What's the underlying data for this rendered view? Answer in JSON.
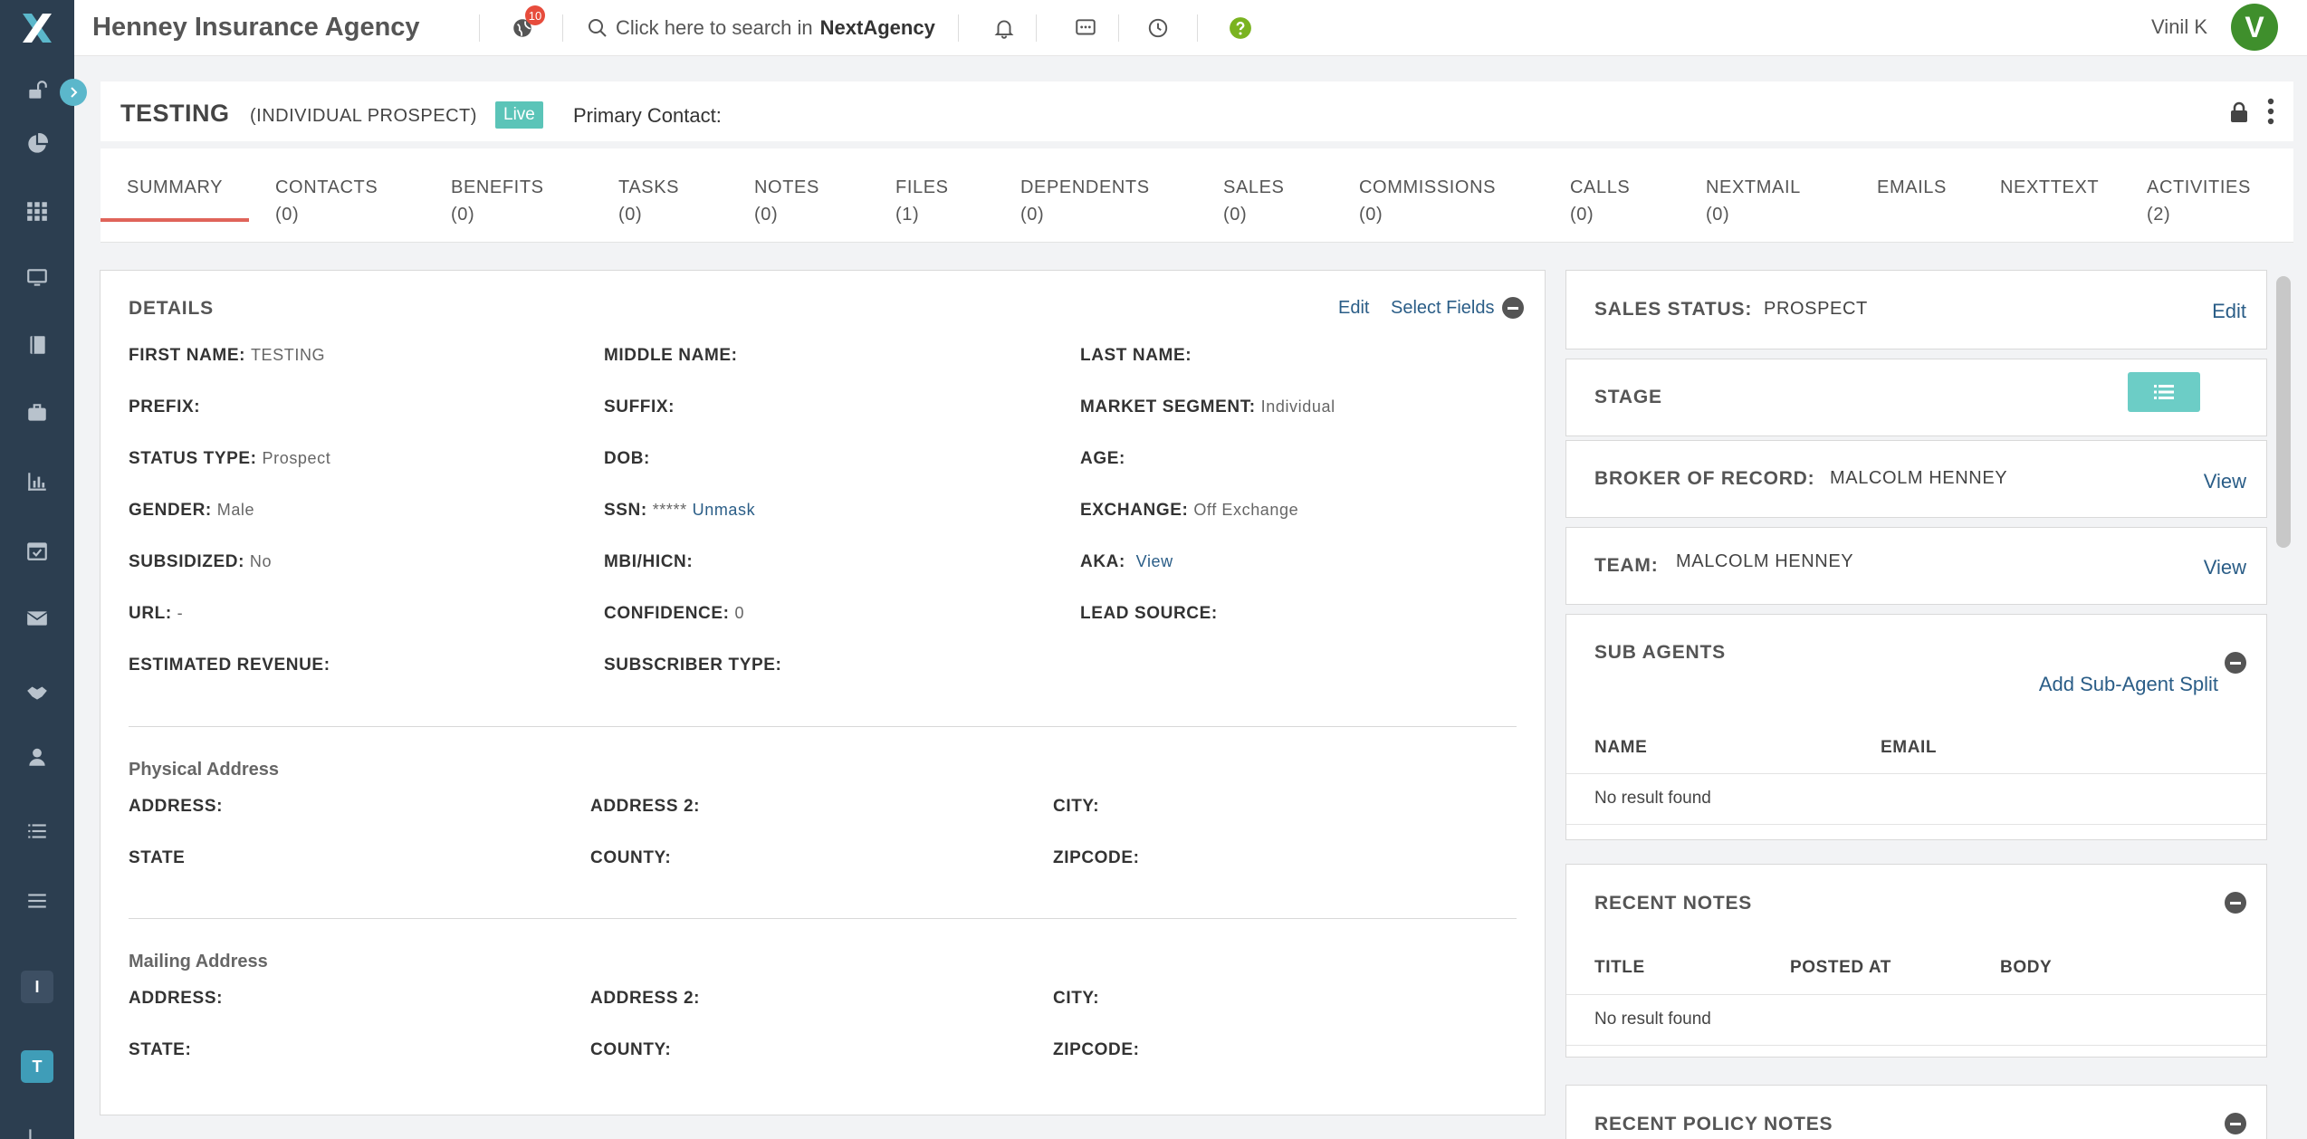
{
  "topbar": {
    "agency_name": "Henney Insurance Agency",
    "notification_count": "10",
    "search_prefix": "Click here to search in",
    "search_brand": "NextAgency",
    "user_name": "Vinil K",
    "avatar_initial": "V"
  },
  "sidebar": {
    "icons": [
      "unlock-icon",
      "pie-chart-icon",
      "grid-icon",
      "monitor-icon",
      "book-icon",
      "briefcase-icon",
      "bar-chart-icon",
      "calendar-check-icon",
      "envelope-icon",
      "handshake-icon",
      "user-icon",
      "list-icon",
      "menu-icon"
    ],
    "letters": [
      "I",
      "T"
    ],
    "colors": {
      "background": "#2c3e50",
      "letter_i_bg": "#3d4f63",
      "letter_t_bg": "#3f9db8"
    }
  },
  "record": {
    "title": "TESTING",
    "type": "(INDIVIDUAL PROSPECT)",
    "status_badge": "Live",
    "primary_contact_label": "Primary Contact:"
  },
  "tabs": [
    {
      "label": "SUMMARY",
      "count": ""
    },
    {
      "label": "CONTACTS",
      "count": "(0)"
    },
    {
      "label": "BENEFITS",
      "count": "(0)"
    },
    {
      "label": "TASKS",
      "count": "(0)"
    },
    {
      "label": "NOTES",
      "count": "(0)"
    },
    {
      "label": "FILES",
      "count": "(1)"
    },
    {
      "label": "DEPENDENTS",
      "count": "(0)"
    },
    {
      "label": "SALES",
      "count": "(0)"
    },
    {
      "label": "COMMISSIONS",
      "count": "(0)"
    },
    {
      "label": "CALLS",
      "count": "(0)"
    },
    {
      "label": "NEXTMAIL",
      "count": "(0)"
    },
    {
      "label": "EMAILS",
      "count": ""
    },
    {
      "label": "NEXTTEXT",
      "count": ""
    },
    {
      "label": "ACTIVITIES",
      "count": "(2)"
    }
  ],
  "details": {
    "title": "DETAILS",
    "edit_label": "Edit",
    "select_fields_label": "Select Fields",
    "fields": {
      "first_name": {
        "label": "FIRST NAME:",
        "value": "TESTING"
      },
      "middle_name": {
        "label": "MIDDLE NAME:",
        "value": ""
      },
      "last_name": {
        "label": "LAST NAME:",
        "value": ""
      },
      "prefix": {
        "label": "PREFIX:",
        "value": ""
      },
      "suffix": {
        "label": "SUFFIX:",
        "value": ""
      },
      "market_segment": {
        "label": "MARKET SEGMENT:",
        "value": "Individual"
      },
      "status_type": {
        "label": "STATUS TYPE:",
        "value": "Prospect"
      },
      "dob": {
        "label": "DOB:",
        "value": ""
      },
      "age": {
        "label": "AGE:",
        "value": ""
      },
      "gender": {
        "label": "GENDER:",
        "value": "Male"
      },
      "ssn": {
        "label": "SSN:",
        "value": "*****",
        "link": "Unmask"
      },
      "exchange": {
        "label": "EXCHANGE:",
        "value": "Off Exchange"
      },
      "subsidized": {
        "label": "SUBSIDIZED:",
        "value": "No"
      },
      "mbi": {
        "label": "MBI/HICN:",
        "value": ""
      },
      "aka": {
        "label": "AKA:",
        "link": "View"
      },
      "url": {
        "label": "URL:",
        "value": "-"
      },
      "confidence": {
        "label": "CONFIDENCE:",
        "value": "0"
      },
      "lead_source": {
        "label": "LEAD SOURCE:",
        "value": ""
      },
      "estimated_revenue": {
        "label": "ESTIMATED REVENUE:",
        "value": ""
      },
      "subscriber_type": {
        "label": "SUBSCRIBER TYPE:",
        "value": ""
      }
    },
    "physical": {
      "heading": "Physical Address",
      "address": "ADDRESS:",
      "address2": "ADDRESS 2:",
      "city": "CITY:",
      "state": "STATE",
      "county": "COUNTY:",
      "zipcode": "ZIPCODE:"
    },
    "mailing": {
      "heading": "Mailing Address",
      "address": "ADDRESS:",
      "address2": "ADDRESS 2:",
      "city": "CITY:",
      "state": "STATE:",
      "county": "COUNTY:",
      "zipcode": "ZIPCODE:"
    }
  },
  "right": {
    "sales_status": {
      "label": "SALES STATUS:",
      "value": "PROSPECT",
      "action": "Edit"
    },
    "stage": {
      "label": "STAGE"
    },
    "broker": {
      "label": "BROKER OF RECORD:",
      "value": "MALCOLM HENNEY",
      "action": "View"
    },
    "team": {
      "label": "TEAM:",
      "value": "MALCOLM HENNEY",
      "action": "View"
    },
    "sub_agents": {
      "label": "SUB AGENTS",
      "action": "Add Sub-Agent Split",
      "columns": [
        "NAME",
        "EMAIL"
      ],
      "empty": "No result found"
    },
    "recent_notes": {
      "label": "RECENT NOTES",
      "columns": [
        "TITLE",
        "POSTED AT",
        "BODY"
      ],
      "empty": "No result found"
    },
    "recent_policy_notes": {
      "label": "RECENT POLICY NOTES"
    }
  },
  "colors": {
    "accent_link": "#2a5d87",
    "live_badge": "#5bc4b8",
    "tab_active_underline": "#e0645a",
    "stage_button": "#6ccdc6",
    "avatar": "#3f8f2c",
    "help_icon": "#7ab320"
  }
}
